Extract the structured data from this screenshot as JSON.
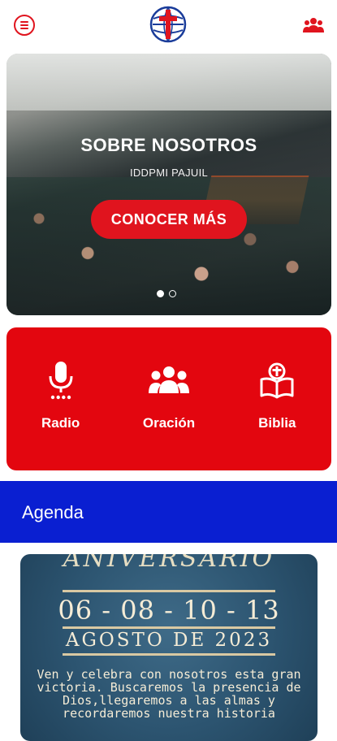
{
  "header": {
    "menu_icon": "menu-icon",
    "logo_icon": "church-cross-globe-logo",
    "group_icon": "people-group-icon",
    "brand_red": "#e0141e"
  },
  "hero": {
    "title": "SOBRE NOSOTROS",
    "subtitle": "IDDPMI PAJUIL",
    "cta_label": "CONOCER MÁS",
    "slides_total": 2,
    "active_slide": 1
  },
  "quick_actions": {
    "background": "#e3060f",
    "items": [
      {
        "label": "Radio",
        "icon": "microphone-icon"
      },
      {
        "label": "Oración",
        "icon": "people-icon"
      },
      {
        "label": "Biblia",
        "icon": "bible-icon"
      }
    ]
  },
  "agenda": {
    "title": "Agenda",
    "bar_color": "#0a1fd1",
    "poster": {
      "top_text": "ANIVERSARIO",
      "dates": "06 - 08 - 10 - 13",
      "month": "AGOSTO DE 2023",
      "body": "Ven y celebra con nosotros esta gran victoria. Buscaremos la presencia de Dios,llegaremos a las almas y recordaremos nuestra historia"
    }
  }
}
